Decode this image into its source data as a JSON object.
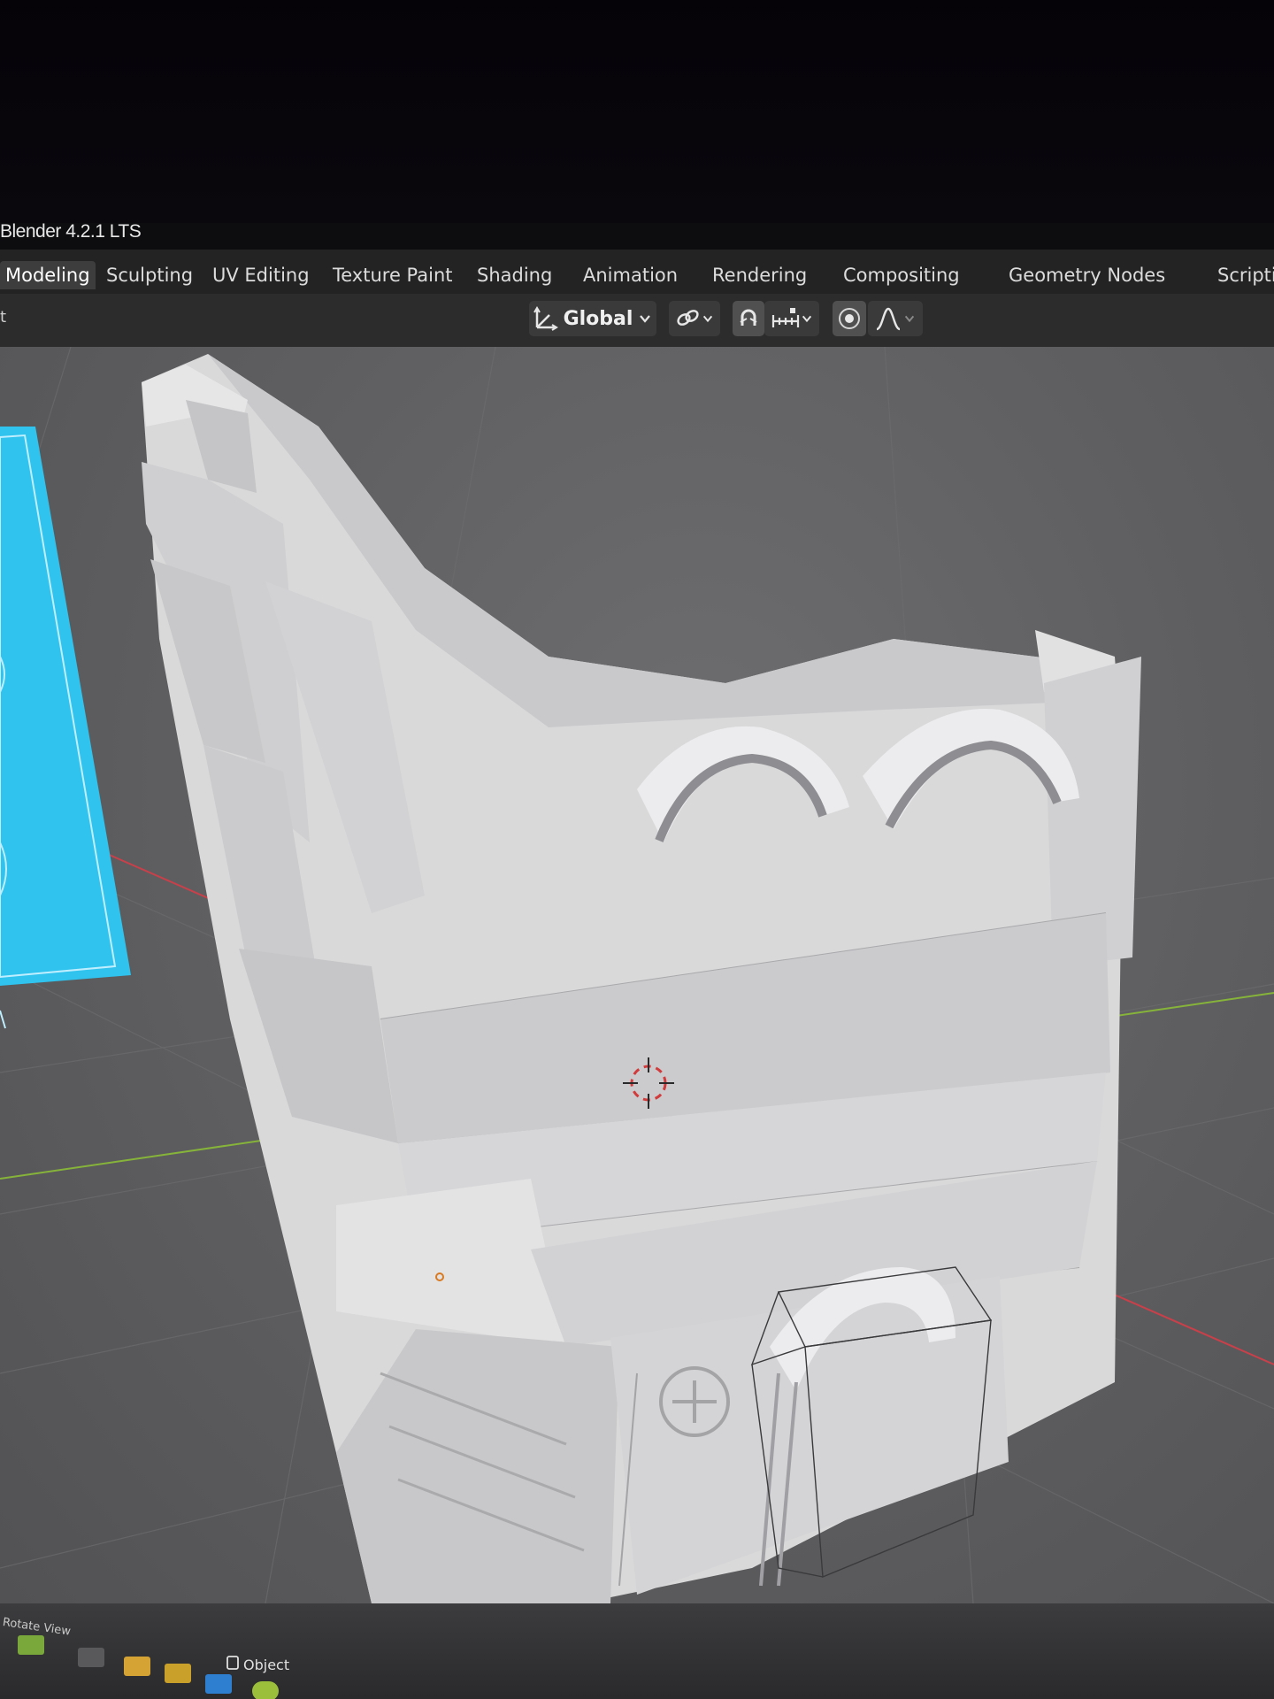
{
  "app": {
    "title": "Blender 4.2.1 LTS"
  },
  "workspace_tabs": [
    {
      "label": "Modeling",
      "active": true
    },
    {
      "label": "Sculpting",
      "active": false
    },
    {
      "label": "UV Editing",
      "active": false
    },
    {
      "label": "Texture Paint",
      "active": false
    },
    {
      "label": "Shading",
      "active": false
    },
    {
      "label": "Animation",
      "active": false
    },
    {
      "label": "Rendering",
      "active": false
    },
    {
      "label": "Compositing",
      "active": false
    },
    {
      "label": "Geometry Nodes",
      "active": false
    },
    {
      "label": "Scripting",
      "active": false
    }
  ],
  "header": {
    "left_label": "t",
    "transform_orientation": "Global",
    "pivot_icon": "link-icon",
    "snap_icon": "magnet-icon",
    "snap_target_icon": "snap-increment-icon",
    "proportional_icon": "proportional-editing-icon",
    "falloff_icon": "falloff-curve-icon"
  },
  "viewport": {
    "background_color": "#5f5f61",
    "x_axis_color": "#c8404a",
    "y_axis_color": "#86b33a",
    "reference_image_color": "#2fc3ee",
    "model_color": "#d9d9da",
    "cursor_icon": "3d-cursor-icon"
  },
  "status_bar": {
    "hint": "Rotate View",
    "mode_label": "Object",
    "mode_icon": "object-mode-icon"
  }
}
